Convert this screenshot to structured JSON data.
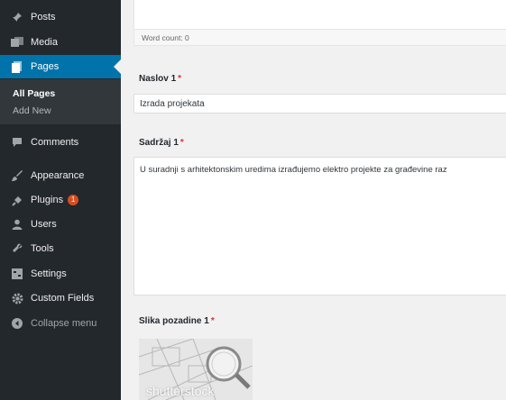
{
  "sidebar": {
    "posts": "Posts",
    "media": "Media",
    "pages": "Pages",
    "all_pages": "All Pages",
    "add_new": "Add New",
    "comments": "Comments",
    "appearance": "Appearance",
    "plugins": "Plugins",
    "plugins_badge": "1",
    "users": "Users",
    "tools": "Tools",
    "settings": "Settings",
    "custom_fields": "Custom Fields",
    "collapse": "Collapse menu"
  },
  "editor": {
    "word_count": "Word count: 0"
  },
  "fields": {
    "naslov_label": "Naslov 1",
    "naslov_value": "Izrada projekata",
    "sadrzaj_label": "Sadržaj 1",
    "sadrzaj_value": "U suradnji s arhitektonskim uredima izrađujemo elektro projekte za građevine raz",
    "slika_label": "Slika pozadine 1",
    "required_mark": "*",
    "thumb_watermark": "shutterstock"
  },
  "colors": {
    "sidebar_bg": "#23282d",
    "active": "#0073aa",
    "badge": "#d54e21"
  }
}
